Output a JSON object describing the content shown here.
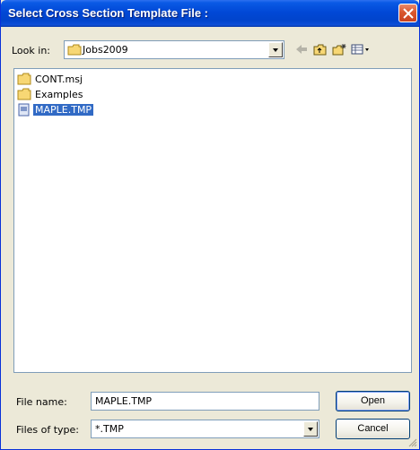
{
  "window": {
    "title": "Select Cross Section Template File :",
    "close_icon": "close-icon"
  },
  "lookin": {
    "label": "Look in:",
    "value": "Jobs2009",
    "icon": "folder-icon"
  },
  "toolbar": {
    "back_icon": "back-arrow-icon",
    "up_icon": "up-folder-icon",
    "new_folder_icon": "new-folder-icon",
    "view_icon": "view-menu-icon"
  },
  "files": [
    {
      "name": "CONT.msj",
      "icon": "folder-icon",
      "selected": false
    },
    {
      "name": "Examples",
      "icon": "folder-icon",
      "selected": false
    },
    {
      "name": "MAPLE.TMP",
      "icon": "file-icon",
      "selected": true
    }
  ],
  "filename": {
    "label": "File name:",
    "value": "MAPLE.TMP"
  },
  "filetype": {
    "label": "Files of type:",
    "value": "*.TMP"
  },
  "buttons": {
    "open": "Open",
    "cancel": "Cancel"
  },
  "colors": {
    "titlebar": "#0148d6",
    "selection": "#316ac5",
    "dialog_bg": "#ece9d8"
  }
}
